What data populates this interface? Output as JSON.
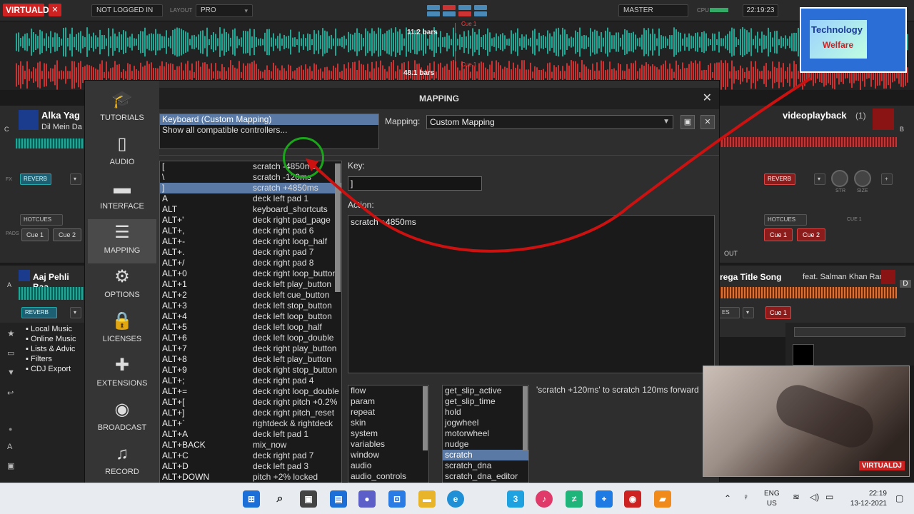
{
  "topbar": {
    "logo": "VIRTUALDJ",
    "not_logged_in": "NOT LOGGED IN",
    "layout_label": "LAYOUT",
    "layout_value": "PRO",
    "master_label": "MASTER",
    "cpu_label": "CPU",
    "clock": "22:19:23"
  },
  "waveform": {
    "bars_top": "11.2 bars",
    "bars_bottom": "48.1 bars",
    "cue_top": "Cue 1",
    "cue_bottom": "Cue 1"
  },
  "brand": {
    "line1": "Technology",
    "line2": "Welfare"
  },
  "decks": {
    "a": {
      "letter": "C",
      "title": "Alka Yag",
      "subtitle": "Dil Mein Da",
      "fx": "REVERB",
      "hotcues": "HOTCUES",
      "cue1": "Cue 1",
      "cue2": "Cue 2"
    },
    "b": {
      "letter": "B",
      "title": "videoplayback",
      "count": "(1)",
      "fx": "REVERB",
      "hotcues": "HOTCUES",
      "cue_label": "CUE 1",
      "cue1": "Cue 1",
      "cue2": "Cue 2",
      "str": "STR",
      "size": "SIZE",
      "out": "OUT"
    },
    "c": {
      "letter": "A",
      "title": "Aaj Pehli Baa",
      "fx": "REVERB"
    },
    "d": {
      "letter": "D",
      "title": "rega Title Song",
      "feat": "feat. Salman Khan Rani",
      "fx": "ES",
      "cue1": "Cue 1"
    }
  },
  "browser": {
    "items": [
      "Local Music",
      "Online Music",
      "Lists & Advic",
      "Filters",
      "CDJ Export"
    ]
  },
  "dialog": {
    "title": "MAPPING",
    "sidebar": [
      {
        "label": "TUTORIALS",
        "icon": "graduation-cap-icon"
      },
      {
        "label": "AUDIO",
        "icon": "speaker-icon"
      },
      {
        "label": "INTERFACE",
        "icon": "monitor-icon"
      },
      {
        "label": "MAPPING",
        "icon": "sliders-icon"
      },
      {
        "label": "OPTIONS",
        "icon": "gear-icon"
      },
      {
        "label": "LICENSES",
        "icon": "lock-icon"
      },
      {
        "label": "EXTENSIONS",
        "icon": "puzzle-icon"
      },
      {
        "label": "BROADCAST",
        "icon": "broadcast-icon"
      },
      {
        "label": "RECORD",
        "icon": "record-icon"
      }
    ],
    "controllers": [
      "Keyboard (Custom Mapping)",
      "Show all compatible controllers..."
    ],
    "mapping_label": "Mapping:",
    "mapping_value": "Custom Mapping",
    "key_label": "Key:",
    "key_value": "]",
    "action_label": "Action:",
    "action_value": "scratch +4850ms",
    "keymap": [
      {
        "key": "[",
        "action": "scratch -4850ms"
      },
      {
        "key": "\\",
        "action": "scratch -120ms"
      },
      {
        "key": "]",
        "action": "scratch +4850ms"
      },
      {
        "key": "A",
        "action": "deck left pad 1"
      },
      {
        "key": "ALT",
        "action": "keyboard_shortcuts"
      },
      {
        "key": "ALT+'",
        "action": "deck right pad_page"
      },
      {
        "key": "ALT+,",
        "action": "deck right pad 6"
      },
      {
        "key": "ALT+-",
        "action": "deck right loop_half"
      },
      {
        "key": "ALT+.",
        "action": "deck right pad 7"
      },
      {
        "key": "ALT+/",
        "action": "deck right pad 8"
      },
      {
        "key": "ALT+0",
        "action": "deck right loop_button"
      },
      {
        "key": "ALT+1",
        "action": "deck left play_button"
      },
      {
        "key": "ALT+2",
        "action": "deck left cue_button"
      },
      {
        "key": "ALT+3",
        "action": "deck left stop_button"
      },
      {
        "key": "ALT+4",
        "action": "deck left loop_button"
      },
      {
        "key": "ALT+5",
        "action": "deck left loop_half"
      },
      {
        "key": "ALT+6",
        "action": "deck left loop_double"
      },
      {
        "key": "ALT+7",
        "action": "deck right play_button"
      },
      {
        "key": "ALT+8",
        "action": "deck left play_button"
      },
      {
        "key": "ALT+9",
        "action": "deck right stop_button"
      },
      {
        "key": "ALT+;",
        "action": "deck right pad 4"
      },
      {
        "key": "ALT+=",
        "action": "deck right loop_double"
      },
      {
        "key": "ALT+[",
        "action": "deck right pitch +0.2%"
      },
      {
        "key": "ALT+]",
        "action": "deck right pitch_reset"
      },
      {
        "key": "ALT+`",
        "action": "rightdeck & rightdeck"
      },
      {
        "key": "ALT+A",
        "action": "deck left pad 1"
      },
      {
        "key": "ALT+BACK",
        "action": "mix_now"
      },
      {
        "key": "ALT+C",
        "action": "deck right pad 7"
      },
      {
        "key": "ALT+D",
        "action": "deck left pad 3"
      },
      {
        "key": "ALT+DOWN",
        "action": "pitch +2% locked"
      }
    ],
    "selected_key_index": 2,
    "categories": [
      "flow",
      "param",
      "repeat",
      "skin",
      "system",
      "variables",
      "window",
      "audio",
      "audio_controls"
    ],
    "verbs": [
      "get_slip_active",
      "get_slip_time",
      "hold",
      "jogwheel",
      "motorwheel",
      "nudge",
      "scratch",
      "scratch_dna",
      "scratch_dna_editor"
    ],
    "selected_verb_index": 6,
    "help_text": "'scratch +120ms' to scratch 120ms forward"
  },
  "video": {
    "watermark": "VIRTUALDJ"
  },
  "taskbar": {
    "lang1": "ENG",
    "lang2": "US",
    "time": "22:19",
    "date": "13-12-2021"
  },
  "colors": {
    "teal_wave": "#1fa796",
    "red_wave": "#c83232",
    "selection": "#5a7aa5",
    "annotation_red": "#cc1111",
    "annotation_green": "#1aa51a"
  }
}
